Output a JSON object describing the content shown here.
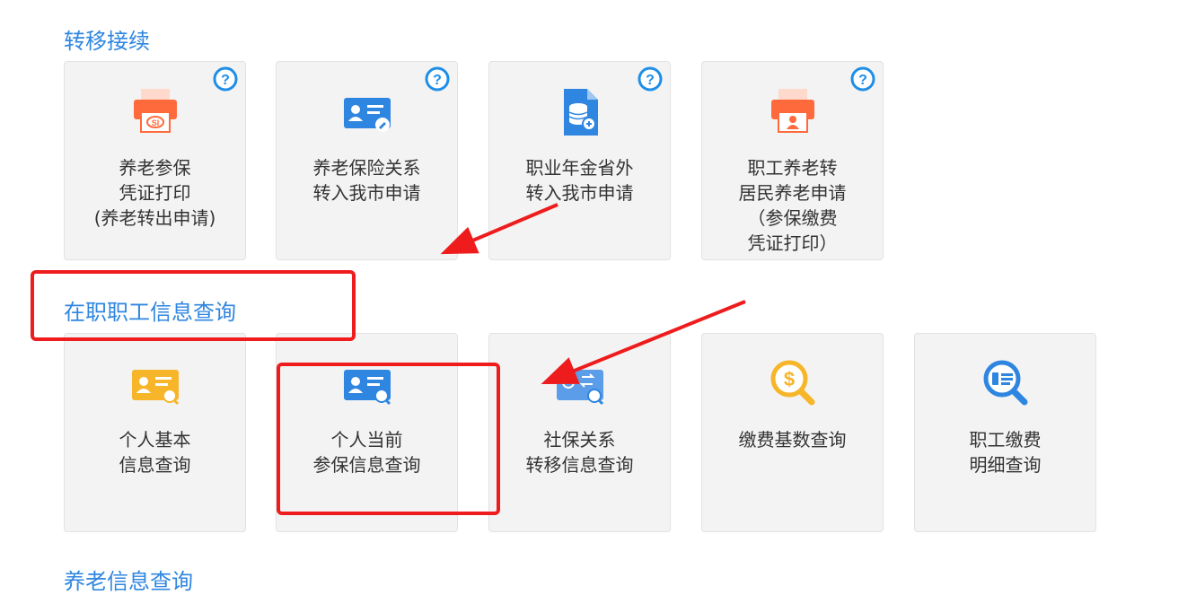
{
  "colors": {
    "section_title": "#2f86e0",
    "help_icon": "#1f8ee6",
    "annotation_red": "#ee1c1c",
    "icon_orange": "#ff6a3d",
    "icon_blue": "#2f86e0",
    "icon_yellow": "#f7b52a"
  },
  "sections": [
    {
      "title": "转移接续",
      "tiles": [
        {
          "label": "养老参保\n凭证打印\n(养老转出申请)",
          "icon": "printer-certificate-icon",
          "help": "question-mark-icon"
        },
        {
          "label": "养老保险关系\n转入我市申请",
          "icon": "id-card-edit-icon",
          "help": "question-mark-icon"
        },
        {
          "label": "职业年金省外\n转入我市申请",
          "icon": "database-document-icon",
          "help": "question-mark-icon"
        },
        {
          "label": "职工养老转\n居民养老申请\n（参保缴费\n凭证打印）",
          "icon": "printer-person-icon",
          "help": "question-mark-icon"
        }
      ]
    },
    {
      "title": "在职职工信息查询",
      "tiles": [
        {
          "label": "个人基本\n信息查询",
          "icon": "id-card-search-yellow-icon"
        },
        {
          "label": "个人当前\n参保信息查询",
          "icon": "id-card-search-blue-icon"
        },
        {
          "label": "社保关系\n转移信息查询",
          "icon": "transfer-card-search-icon"
        },
        {
          "label": "缴费基数查询",
          "icon": "money-magnifier-icon"
        },
        {
          "label": "职工缴费\n明细查询",
          "icon": "detail-magnifier-icon"
        }
      ]
    },
    {
      "title": "养老信息查询"
    }
  ]
}
